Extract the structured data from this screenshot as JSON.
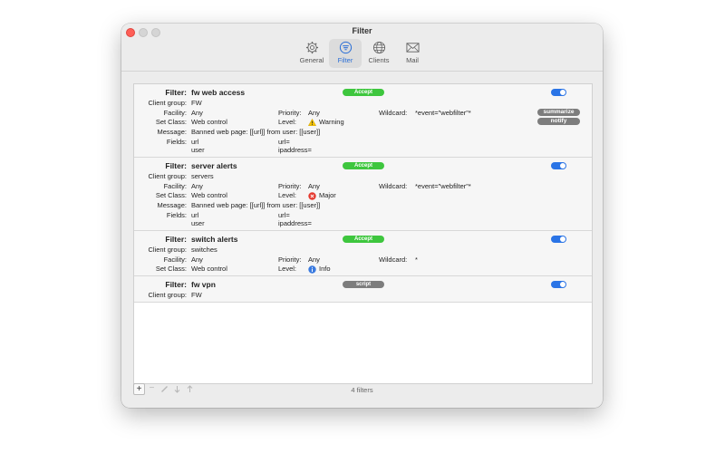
{
  "window": {
    "title": "Filter"
  },
  "toolbar": {
    "items": [
      {
        "label": "General",
        "icon": "gear-icon"
      },
      {
        "label": "Filter",
        "icon": "filter-icon",
        "active": true
      },
      {
        "label": "Clients",
        "icon": "globe-icon"
      },
      {
        "label": "Mail",
        "icon": "envelope-icon"
      }
    ]
  },
  "labels": {
    "filter": "Filter:",
    "client_group": "Client group:",
    "facility": "Facility:",
    "priority": "Priority:",
    "wildcard": "Wildcard:",
    "set_class": "Set Class:",
    "level": "Level:",
    "message": "Message:",
    "fields": "Fields:"
  },
  "filters": [
    {
      "name": "fw web access",
      "action": "Accept",
      "enabled": true,
      "client_group": "FW",
      "facility": "Any",
      "priority": "Any",
      "wildcard": "*event=\"webfilter\"*",
      "set_class": "Web control",
      "level": "Warning",
      "level_icon": "warning-icon",
      "message": "Banned web page: [[url]] from user: [[user]]",
      "fields_col1": [
        "url",
        "user"
      ],
      "fields_col2": [
        "url=",
        "ipaddress="
      ],
      "actions": [
        "summarize",
        "notify"
      ]
    },
    {
      "name": "server alerts",
      "action": "Accept",
      "enabled": true,
      "client_group": "servers",
      "facility": "Any",
      "priority": "Any",
      "wildcard": "*event=\"webfilter\"*",
      "set_class": "Web control",
      "level": "Major",
      "level_icon": "error-icon",
      "message": "Banned web page: [[url]] from user: [[user]]",
      "fields_col1": [
        "url",
        "user"
      ],
      "fields_col2": [
        "url=",
        "ipaddress="
      ]
    },
    {
      "name": "switch alerts",
      "action": "Accept",
      "enabled": true,
      "client_group": "switches",
      "facility": "Any",
      "priority": "Any",
      "wildcard": "*",
      "set_class": "Web control",
      "level": "Info",
      "level_icon": "info-icon"
    },
    {
      "name": "fw vpn",
      "action": "script",
      "enabled": true,
      "client_group": "FW"
    }
  ],
  "footer": {
    "count": "4 filters"
  },
  "colors": {
    "accept": "#3ec63e",
    "script": "#7d7d7d",
    "toggle": "#2a74e6",
    "active_tab": "#2b6fd6"
  }
}
